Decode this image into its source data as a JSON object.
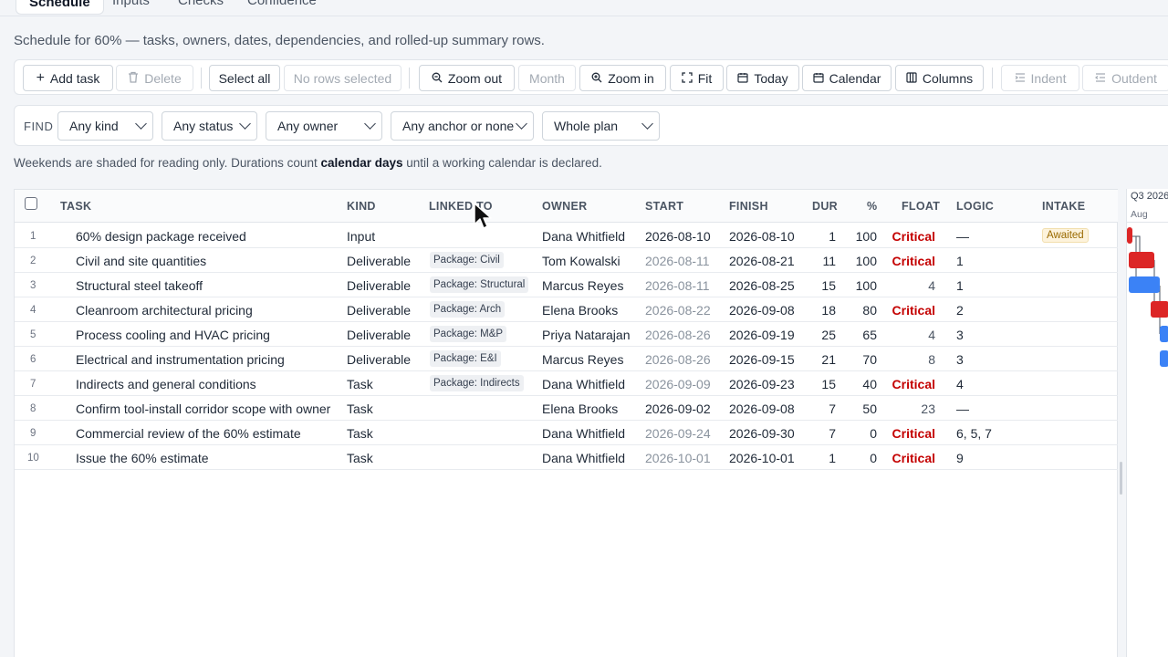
{
  "tabs": [
    "Schedule",
    "Inputs",
    "Checks",
    "Confidence"
  ],
  "subtitle": "Schedule for 60% — tasks, owners, dates, dependencies, and rolled-up summary rows.",
  "toolbar": {
    "add_task": "Add task",
    "delete": "Delete",
    "select_all": "Select all",
    "no_rows": "No rows selected",
    "zoom_out": "Zoom out",
    "month": "Month",
    "zoom_in": "Zoom in",
    "fit": "Fit",
    "today": "Today",
    "calendar": "Calendar",
    "columns": "Columns",
    "indent": "Indent",
    "outdent": "Outdent"
  },
  "find": {
    "label": "FIND",
    "kind": "Any kind",
    "status": "Any status",
    "owner": "Any owner",
    "anchor": "Any anchor or none",
    "scope": "Whole plan"
  },
  "note": {
    "before": "Weekends are shaded for reading only. Durations count ",
    "bold": "calendar days",
    "after": " until a working calendar is declared."
  },
  "columns": [
    "TASK",
    "KIND",
    "LINKED TO",
    "OWNER",
    "START",
    "FINISH",
    "DUR",
    "%",
    "FLOAT",
    "LOGIC",
    "INTAKE"
  ],
  "rows": [
    {
      "n": "1",
      "task": "60% design package received",
      "kind": "Input",
      "link": "",
      "owner": "Dana Whitfield",
      "start": "2026-08-10",
      "finish": "2026-08-10",
      "dur": "1",
      "pct": "100",
      "float": "Critical",
      "logic": "—",
      "intake": "Awaited"
    },
    {
      "n": "2",
      "task": "Civil and site quantities",
      "kind": "Deliverable",
      "link": "Package: Civil",
      "owner": "Tom Kowalski",
      "start": "2026-08-11",
      "finish": "2026-08-21",
      "dur": "11",
      "pct": "100",
      "float": "Critical",
      "logic": "1",
      "intake": ""
    },
    {
      "n": "3",
      "task": "Structural steel takeoff",
      "kind": "Deliverable",
      "link": "Package: Structural",
      "owner": "Marcus Reyes",
      "start": "2026-08-11",
      "finish": "2026-08-25",
      "dur": "15",
      "pct": "100",
      "float": "4",
      "logic": "1",
      "intake": ""
    },
    {
      "n": "4",
      "task": "Cleanroom architectural pricing",
      "kind": "Deliverable",
      "link": "Package: Arch",
      "owner": "Elena Brooks",
      "start": "2026-08-22",
      "finish": "2026-09-08",
      "dur": "18",
      "pct": "80",
      "float": "Critical",
      "logic": "2",
      "intake": ""
    },
    {
      "n": "5",
      "task": "Process cooling and HVAC pricing",
      "kind": "Deliverable",
      "link": "Package: M&P",
      "owner": "Priya Natarajan",
      "start": "2026-08-26",
      "finish": "2026-09-19",
      "dur": "25",
      "pct": "65",
      "float": "4",
      "logic": "3",
      "intake": ""
    },
    {
      "n": "6",
      "task": "Electrical and instrumentation pricing",
      "kind": "Deliverable",
      "link": "Package: E&I",
      "owner": "Marcus Reyes",
      "start": "2026-08-26",
      "finish": "2026-09-15",
      "dur": "21",
      "pct": "70",
      "float": "8",
      "logic": "3",
      "intake": ""
    },
    {
      "n": "7",
      "task": "Indirects and general conditions",
      "kind": "Task",
      "link": "Package: Indirects",
      "owner": "Dana Whitfield",
      "start": "2026-09-09",
      "finish": "2026-09-23",
      "dur": "15",
      "pct": "40",
      "float": "Critical",
      "logic": "4",
      "intake": ""
    },
    {
      "n": "8",
      "task": "Confirm tool-install corridor scope with owner",
      "kind": "Task",
      "link": "",
      "owner": "Elena Brooks",
      "start": "2026-09-02",
      "finish": "2026-09-08",
      "dur": "7",
      "pct": "50",
      "float": "23",
      "logic": "—",
      "intake": ""
    },
    {
      "n": "9",
      "task": "Commercial review of the 60% estimate",
      "kind": "Task",
      "link": "",
      "owner": "Dana Whitfield",
      "start": "2026-09-24",
      "finish": "2026-09-30",
      "dur": "7",
      "pct": "0",
      "float": "Critical",
      "logic": "6, 5, 7",
      "intake": ""
    },
    {
      "n": "10",
      "task": "Issue the 60% estimate",
      "kind": "Task",
      "link": "",
      "owner": "Dana Whitfield",
      "start": "2026-10-01",
      "finish": "2026-10-01",
      "dur": "1",
      "pct": "0",
      "float": "Critical",
      "logic": "9",
      "intake": ""
    }
  ],
  "muted_start_rows": [
    "2",
    "3",
    "4",
    "5",
    "6",
    "7",
    "9",
    "10"
  ],
  "gantt": {
    "quarter": "Q3 2026",
    "month": "Aug"
  },
  "colors": {
    "critical": "#c40000",
    "bar_critical": "#dc2626",
    "bar_normal": "#3b82f6"
  }
}
